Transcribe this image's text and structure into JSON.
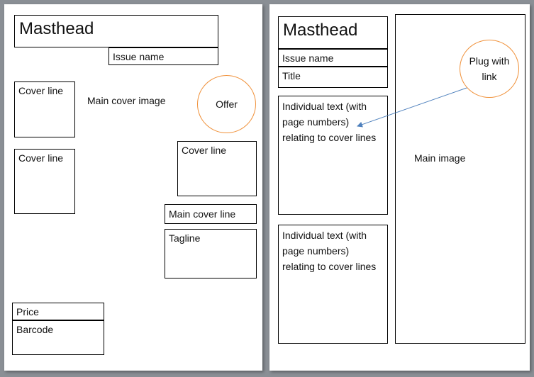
{
  "left": {
    "masthead": "Masthead",
    "issue_name": "Issue name",
    "cover_line_1": "Cover line",
    "main_cover_image": "Main cover image",
    "offer": "Offer",
    "cover_line_2": "Cover line",
    "cover_line_3": "Cover line",
    "main_cover_line": "Main cover line",
    "tagline": "Tagline",
    "price": "Price",
    "barcode": "Barcode"
  },
  "right": {
    "masthead": "Masthead",
    "issue_name": "Issue name",
    "title": "Title",
    "text_1": "Individual text (with page numbers) relating to cover lines",
    "text_2": "Individual text (with page numbers) relating to cover lines",
    "plug": "Plug with link",
    "main_image": "Main image"
  },
  "colors": {
    "circle_outline": "#f0913a",
    "arrow": "#4f81bd"
  }
}
